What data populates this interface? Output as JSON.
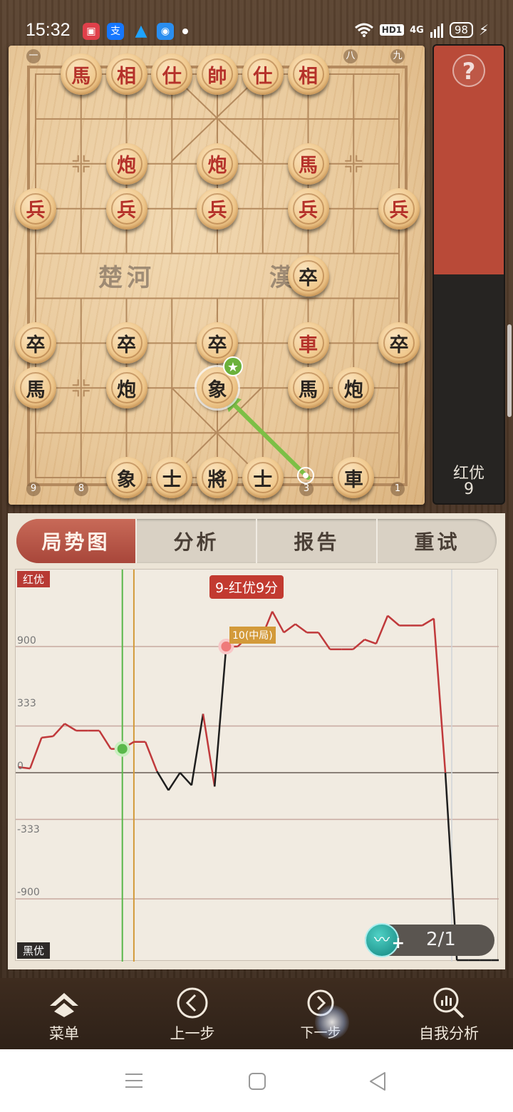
{
  "status_bar": {
    "time": "15:32",
    "hd_label": "HD1",
    "network_label": "4G",
    "battery": "98",
    "icons": [
      "video-app-icon",
      "alipay-app-icon",
      "qq-app-icon",
      "browser-app-icon",
      "wifi-icon",
      "signal-icon",
      "charging-icon"
    ]
  },
  "board": {
    "top_coords": [
      "一",
      "八",
      "九"
    ],
    "bottom_coords": [
      "9",
      "8",
      "3",
      "1"
    ],
    "river_left": "楚河",
    "river_right": "漢界",
    "pieces": [
      {
        "c": 1,
        "r": 0,
        "t": "馬",
        "s": "red"
      },
      {
        "c": 2,
        "r": 0,
        "t": "相",
        "s": "red"
      },
      {
        "c": 3,
        "r": 0,
        "t": "仕",
        "s": "red"
      },
      {
        "c": 4,
        "r": 0,
        "t": "帥",
        "s": "red"
      },
      {
        "c": 5,
        "r": 0,
        "t": "仕",
        "s": "red"
      },
      {
        "c": 6,
        "r": 0,
        "t": "相",
        "s": "red"
      },
      {
        "c": 2,
        "r": 2,
        "t": "炮",
        "s": "red"
      },
      {
        "c": 4,
        "r": 2,
        "t": "炮",
        "s": "red"
      },
      {
        "c": 6,
        "r": 2,
        "t": "馬",
        "s": "red"
      },
      {
        "c": 0,
        "r": 3,
        "t": "兵",
        "s": "red"
      },
      {
        "c": 2,
        "r": 3,
        "t": "兵",
        "s": "red"
      },
      {
        "c": 4,
        "r": 3,
        "t": "兵",
        "s": "red"
      },
      {
        "c": 6,
        "r": 3,
        "t": "兵",
        "s": "red"
      },
      {
        "c": 8,
        "r": 3,
        "t": "兵",
        "s": "red"
      },
      {
        "c": 6,
        "r": 4.5,
        "t": "卒",
        "s": "black"
      },
      {
        "c": 0,
        "r": 6,
        "t": "卒",
        "s": "black"
      },
      {
        "c": 2,
        "r": 6,
        "t": "卒",
        "s": "black"
      },
      {
        "c": 4,
        "r": 6,
        "t": "卒",
        "s": "black"
      },
      {
        "c": 6,
        "r": 6,
        "t": "車",
        "s": "red"
      },
      {
        "c": 8,
        "r": 6,
        "t": "卒",
        "s": "black"
      },
      {
        "c": 0,
        "r": 7,
        "t": "馬",
        "s": "black"
      },
      {
        "c": 2,
        "r": 7,
        "t": "炮",
        "s": "black"
      },
      {
        "c": 4,
        "r": 7,
        "t": "象",
        "s": "black",
        "selected": true
      },
      {
        "c": 6,
        "r": 7,
        "t": "馬",
        "s": "black"
      },
      {
        "c": 7,
        "r": 7,
        "t": "炮",
        "s": "black"
      },
      {
        "c": 2,
        "r": 9,
        "t": "象",
        "s": "black"
      },
      {
        "c": 3,
        "r": 9,
        "t": "士",
        "s": "black"
      },
      {
        "c": 4,
        "r": 9,
        "t": "將",
        "s": "black"
      },
      {
        "c": 5,
        "r": 9,
        "t": "士",
        "s": "black"
      },
      {
        "c": 7,
        "r": 9,
        "t": "車",
        "s": "black"
      }
    ],
    "move_arrow": {
      "from": [
        6,
        9
      ],
      "to": [
        4,
        7
      ]
    },
    "star_symbol": "★"
  },
  "eval_bar": {
    "help_symbol": "?",
    "label": "红优",
    "score": "9",
    "red_fraction": 0.5
  },
  "tabs": [
    {
      "label": "局势图",
      "active": true
    },
    {
      "label": "分析",
      "active": false
    },
    {
      "label": "报告",
      "active": false
    },
    {
      "label": "重试",
      "active": false
    }
  ],
  "graph": {
    "top_tag": "红优",
    "bottom_tag": "黑优",
    "y_ticks": [
      "900",
      "333",
      "0",
      "-333",
      "-900"
    ],
    "move_tag": "9-红优9分",
    "phase_tag": "10(中局)",
    "counter": "2/1",
    "colors": {
      "red": "#c0393b",
      "black": "#1e1e1e",
      "current": "#59b84a",
      "phase": "#d39a3a"
    }
  },
  "chart_data": {
    "type": "line",
    "ylim": [
      -1200,
      1200
    ],
    "y_ticks": [
      900,
      333,
      0,
      -333,
      -900
    ],
    "x": [
      0,
      1,
      2,
      3,
      4,
      5,
      6,
      7,
      8,
      9,
      10,
      11,
      12,
      13,
      14,
      15,
      16,
      17,
      18,
      19,
      20,
      21,
      22,
      23,
      24,
      25,
      26,
      27,
      28,
      29,
      30,
      31,
      32,
      33,
      34,
      35,
      36,
      37,
      38,
      39,
      40,
      41,
      42
    ],
    "values": [
      40,
      30,
      250,
      260,
      350,
      300,
      300,
      300,
      170,
      170,
      220,
      220,
      10,
      -140,
      0,
      -100,
      420,
      -110,
      900,
      900,
      980,
      950,
      1150,
      1000,
      1060,
      1000,
      1000,
      880,
      880,
      880,
      950,
      920,
      1120,
      1050,
      1050,
      1050,
      1100,
      0,
      -1600,
      -1600,
      -1600,
      -1600,
      -1600
    ],
    "current_move": 9,
    "phase_marker": {
      "move": 10,
      "label": "10(中局)"
    },
    "highlight_move": 18
  },
  "bottom_nav": [
    {
      "label": "菜单",
      "icon": "menu-chevron-icon"
    },
    {
      "label": "上一步",
      "icon": "previous-step-icon"
    },
    {
      "label": "下一步",
      "icon": "next-step-icon"
    },
    {
      "label": "自我分析",
      "icon": "self-analysis-icon"
    }
  ],
  "system_nav": [
    "recent-apps-icon",
    "home-icon",
    "back-icon"
  ]
}
